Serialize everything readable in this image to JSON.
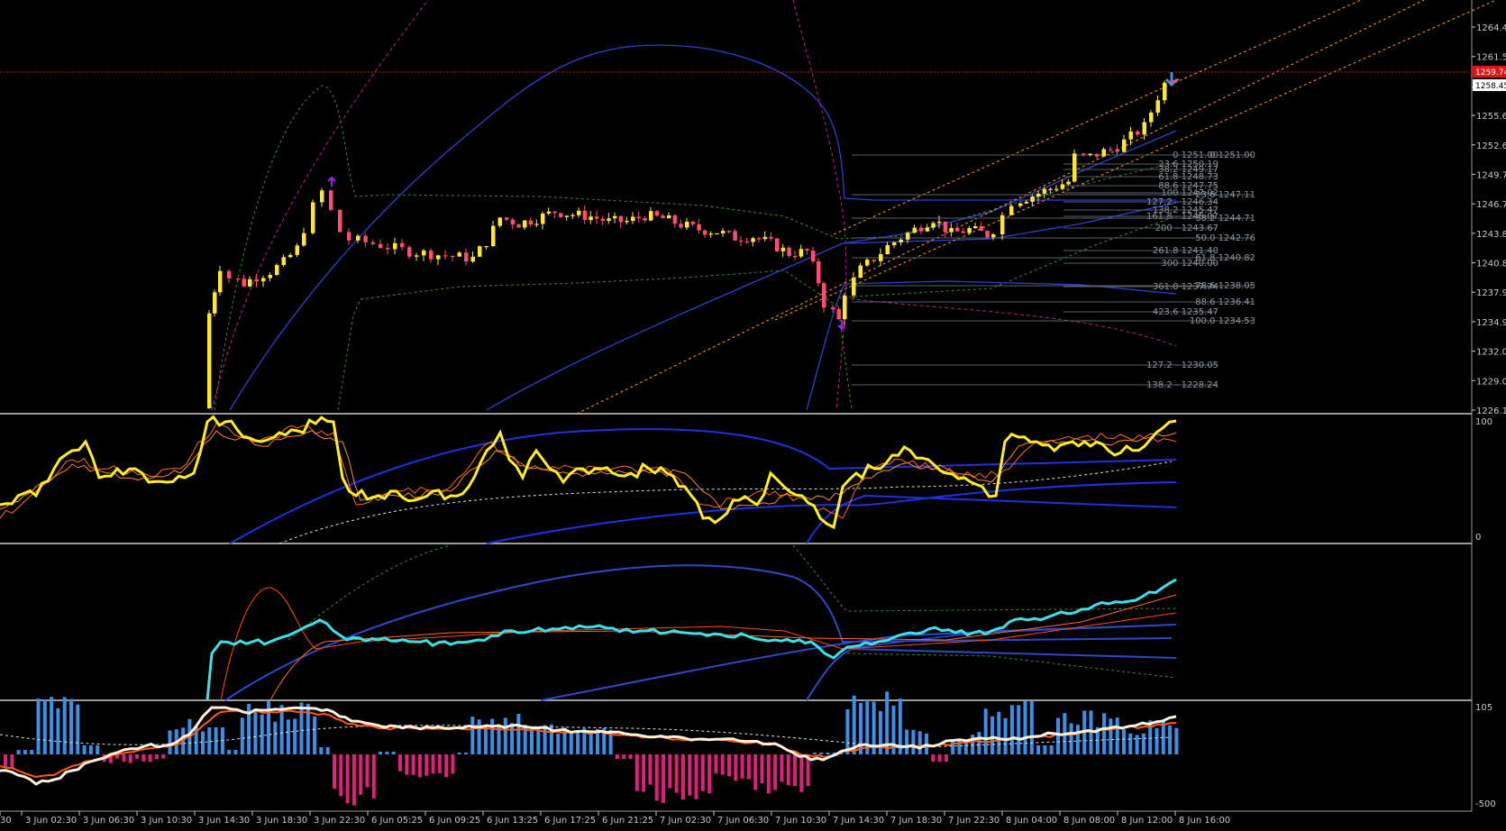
{
  "price_axis": {
    "labels": [
      "1264.47",
      "1261.52",
      "1258.45",
      "1255.62",
      "1252.67",
      "1249.72",
      "1246.77",
      "1243.82",
      "1240.87",
      "1237.92",
      "1234.97",
      "1232.02",
      "1229.07",
      "1226.12"
    ],
    "values": [
      1264.47,
      1261.52,
      1258.45,
      1255.62,
      1252.67,
      1249.72,
      1246.77,
      1243.82,
      1240.87,
      1237.92,
      1234.97,
      1232.02,
      1229.07,
      1226.12
    ],
    "current_price": "1259.74",
    "current_price_value": 1259.74,
    "bid_price": "1258.45",
    "bid_price_value": 1258.45
  },
  "time_axis": {
    "labels": [
      "30",
      "3 Jun 02:30",
      "3 Jun 06:30",
      "3 Jun 10:30",
      "3 Jun 14:30",
      "3 Jun 18:30",
      "3 Jun 22:30",
      "6 Jun 05:25",
      "6 Jun 09:25",
      "6 Jun 13:25",
      "6 Jun 17:25",
      "6 Jun 21:25",
      "7 Jun 02:30",
      "7 Jun 06:30",
      "7 Jun 10:30",
      "7 Jun 14:30",
      "7 Jun 18:30",
      "7 Jun 22:30",
      "8 Jun 04:00",
      "8 Jun 08:00",
      "8 Jun 12:00",
      "8 Jun 16:00"
    ]
  },
  "fib_levels": {
    "left": [
      "0 1251.00",
      "23.6 1250.19",
      "38.2 1249.17",
      "61.8 1248.73",
      "88.6 1247.75",
      "100 1247.02",
      "127.2 - 1246.34",
      "138.2 1245.47",
      "161.8 - 1245.07",
      "200 - 1243.67",
      "261.8 1241.40",
      "300 1240.00",
      "361.8 1237.74",
      "423.6 1235.47",
      "127.2 - 1230.05",
      "138.2 - 1228.24"
    ],
    "right": [
      "0 1251.00",
      "23.6 1247.11",
      "38.2 1244.71",
      "50.0 1242.76",
      "61.8 1240.82",
      "78.6 1238.05",
      "88.6 1236.41",
      "100.0 1234.53"
    ]
  },
  "indicator_axes": {
    "stoch_top": "100",
    "stoch_bottom": "0",
    "osc_top": "105",
    "osc_bottom": "-500"
  },
  "colors": {
    "background": "#000000",
    "bull_candle": "#ffe633",
    "bear_candle": "#ff4d6d",
    "current_price_line": "#c81e1e",
    "current_price_tag": "#e01414",
    "channel": "#ff9a1a",
    "envelope_blue": "#2f3fc8",
    "band_green": "#3a8a2a",
    "band_magenta": "#b0208a",
    "stoch_line": "#ffee22",
    "momentum_line": "#3ce0e8",
    "hist_up": "#3c8fe6",
    "hist_down": "#e0207a",
    "osc_white": "#fff0d8",
    "osc_orange": "#ff5a14",
    "fib_line": "#56606a",
    "fib_text": "#8c969c",
    "grid_sep": "#9a9a9a"
  }
}
